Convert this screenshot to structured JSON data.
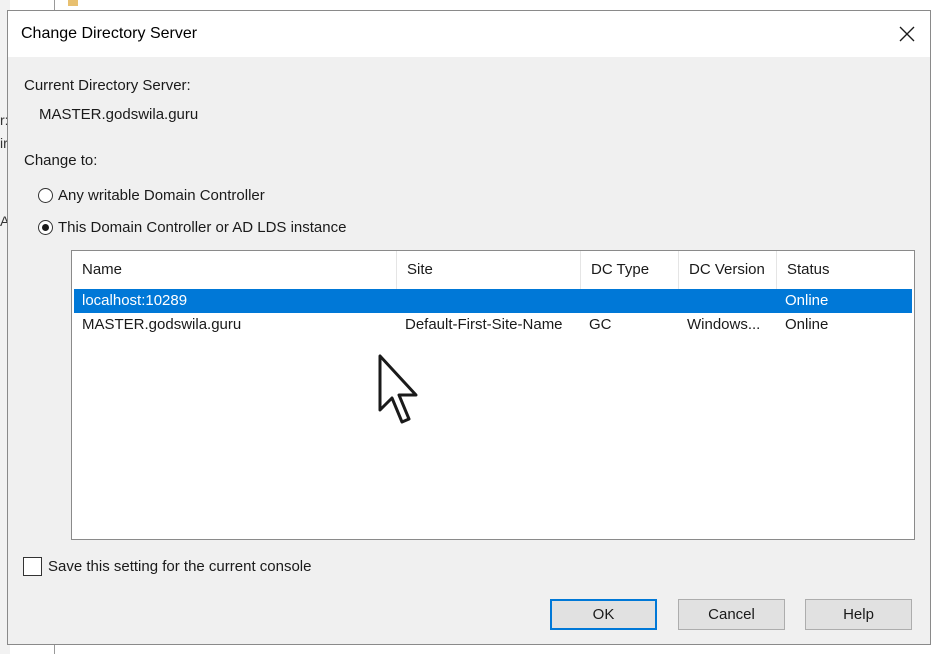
{
  "background": {
    "fragments": [
      "r:",
      "ir",
      "A"
    ]
  },
  "dialog": {
    "title": "Change Directory Server",
    "current_label": "Current Directory Server:",
    "current_value": "MASTER.godswila.guru",
    "change_to_label": "Change to:",
    "radio_any": "Any writable Domain Controller",
    "radio_this": "This Domain Controller or AD LDS instance",
    "selected_radio": "this",
    "columns": [
      "Name",
      "Site",
      "DC Type",
      "DC Version",
      "Status"
    ],
    "rows": [
      {
        "name": "localhost:10289",
        "site": "",
        "dc_type": "",
        "dc_version": "",
        "status": "Online",
        "selected": true
      },
      {
        "name": "MASTER.godswila.guru",
        "site": "Default-First-Site-Name",
        "dc_type": "GC",
        "dc_version": "Windows...",
        "status": "Online",
        "selected": false
      }
    ],
    "save_setting_label": "Save this setting for the current console",
    "save_setting_checked": false,
    "buttons": {
      "ok": "OK",
      "cancel": "Cancel",
      "help": "Help"
    }
  },
  "colors": {
    "selection": "#0078d7",
    "dialog_bg": "#f0f0f0"
  },
  "icons": {
    "close": "close-icon",
    "cursor": "mouse-pointer-icon"
  }
}
